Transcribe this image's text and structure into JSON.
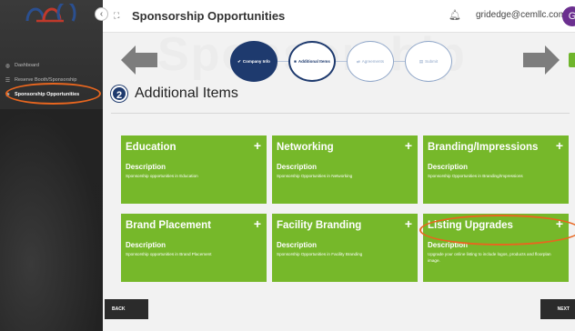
{
  "header": {
    "title": "Sponsorship Opportunities",
    "email": "gridedge@cemllc.com",
    "avatar_letter": "G"
  },
  "sidebar": {
    "items": [
      {
        "label": "Dashboard",
        "icon": "dashboard-icon"
      },
      {
        "label": "Reserve Booth/Sponsorship",
        "icon": "list-icon"
      },
      {
        "label": "Sponsorship Opportunities",
        "icon": "flag-icon"
      }
    ]
  },
  "background_text": "Sponsorship",
  "steps": [
    {
      "label": "Company Info"
    },
    {
      "label": "Additional Items"
    },
    {
      "label": "Agreements"
    },
    {
      "label": "Submit"
    }
  ],
  "section": {
    "number": "2",
    "title": "Additional Items"
  },
  "cards": [
    {
      "title": "Education",
      "desc_label": "Description",
      "desc": "Sponsorship opportunities in Education"
    },
    {
      "title": "Networking",
      "desc_label": "Description",
      "desc": "Sponsorship Opportunities in Networking"
    },
    {
      "title": "Branding/Impressions",
      "desc_label": "Description",
      "desc": "Sponsorship Opportunities in Branding/Impressions"
    },
    {
      "title": "Brand Placement",
      "desc_label": "Description",
      "desc": "Sponsorship opportunities in Brand Placement"
    },
    {
      "title": "Facility Branding",
      "desc_label": "Description",
      "desc": "Sponsorship Opportunities in Facility Branding"
    },
    {
      "title": "Listing Upgrades",
      "desc_label": "Description",
      "desc": "Upgrade your online listing to include logos, products and floorplan image."
    }
  ],
  "buttons": {
    "back": "BACK",
    "next": "NEXT"
  },
  "colors": {
    "card_green": "#76b82a",
    "step_blue": "#1e3a6e",
    "highlight": "#e8661f",
    "avatar": "#6b2f8f"
  }
}
